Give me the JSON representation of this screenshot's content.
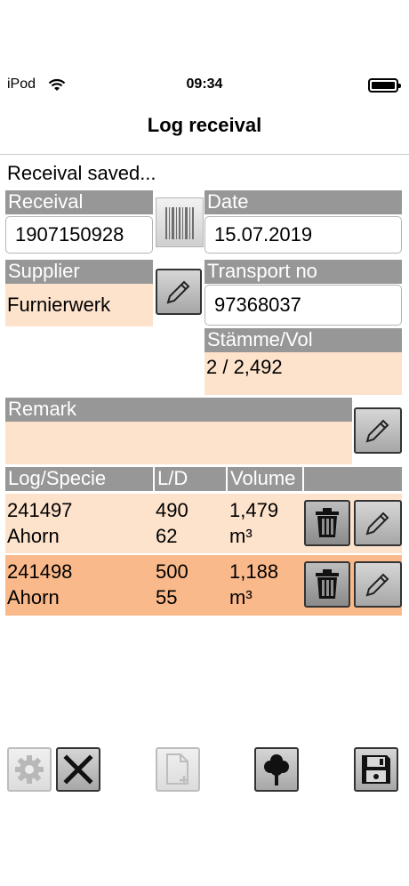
{
  "status_bar": {
    "carrier": "iPod",
    "time": "09:34"
  },
  "nav": {
    "title": "Log receival"
  },
  "message": "Receival saved...",
  "form": {
    "receival_label": "Receival",
    "receival_value": "1907150928",
    "date_label": "Date",
    "date_value": "15.07.2019",
    "supplier_label": "Supplier",
    "supplier_value": "Furnierwerk",
    "transport_label": "Transport no",
    "transport_value": "97368037",
    "staemme_label": "Stämme/Vol",
    "staemme_value": "2 / 2,492",
    "remark_label": "Remark",
    "remark_value": ""
  },
  "table": {
    "headers": [
      "Log/Specie",
      "L/D",
      "Volume"
    ],
    "rows": [
      {
        "log": "241497",
        "specie": "Ahorn",
        "length": "490",
        "diameter": "62",
        "volume": "1,479",
        "unit": "m³"
      },
      {
        "log": "241498",
        "specie": "Ahorn",
        "length": "500",
        "diameter": "55",
        "volume": "1,188",
        "unit": "m³"
      }
    ]
  },
  "icons": {
    "wifi": "wifi-icon",
    "battery": "battery-icon",
    "barcode": "barcode-icon",
    "pencil": "pencil-icon",
    "trash": "trash-icon",
    "gear": "gear-icon",
    "close": "close-icon",
    "new_doc": "new-document-icon",
    "tree": "tree-icon",
    "save": "save-icon"
  },
  "colors": {
    "header": "#979797",
    "row_light": "#fde2cc",
    "row_dark": "#fab98a"
  }
}
